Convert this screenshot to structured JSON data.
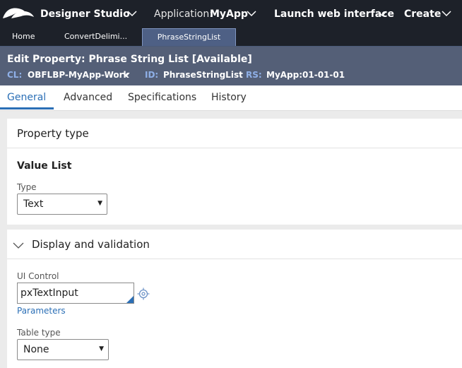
{
  "topbar": {
    "studio": "Designer Studio",
    "application_label": "Application:",
    "application_value": "MyApp",
    "launch": "Launch web interface",
    "create": "Create"
  },
  "tabs": [
    {
      "label": "Home"
    },
    {
      "label": "ConvertDelimi..."
    },
    {
      "label": "PhraseStringList"
    }
  ],
  "header": {
    "edit_label": "Edit  Property:",
    "property_name": "Phrase String List",
    "status": "[Available]",
    "cl_label": "CL:",
    "cl_value": "OBFLBP-MyApp-Work",
    "id_label": "ID:",
    "id_value": "PhraseStringList",
    "rs_label": "RS:",
    "rs_value": "MyApp:01-01-01"
  },
  "subtabs": [
    {
      "label": "General"
    },
    {
      "label": "Advanced"
    },
    {
      "label": "Specifications"
    },
    {
      "label": "History"
    }
  ],
  "property_type": {
    "title": "Property type",
    "mode": "Value List",
    "type_label": "Type",
    "type_value": "Text"
  },
  "display": {
    "title": "Display and validation",
    "ui_control_label": "UI Control",
    "ui_control_value": "pxTextInput",
    "parameters_link": "Parameters",
    "table_type_label": "Table type",
    "table_type_value": "None"
  },
  "colors": {
    "topbar": "#1d2129",
    "header": "#545f77",
    "accent": "#2b6fb6",
    "header_key": "#8fb0e8"
  }
}
